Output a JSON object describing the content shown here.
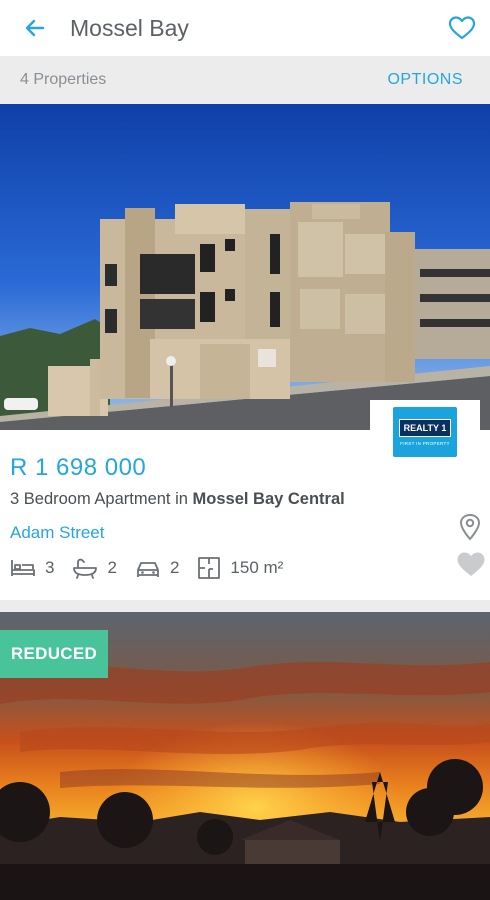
{
  "header": {
    "title": "Mossel Bay"
  },
  "subbar": {
    "count": "4 Properties",
    "options_label": "OPTIONS"
  },
  "listings": [
    {
      "price": "R 1 698 000",
      "description_prefix": "3 Bedroom Apartment in ",
      "description_location": "Mossel Bay Central",
      "street": "Adam Street",
      "bedrooms": "3",
      "bathrooms": "2",
      "garages": "2",
      "floor_size": "150 m²",
      "agency_logo_text": "REALTY 1",
      "agency_logo_subtext": "FIRST IN PROPERTY"
    },
    {
      "badge": "REDUCED"
    }
  ],
  "colors": {
    "accent": "#25a6e0",
    "badge_green": "#49c49a"
  },
  "icons": [
    "back-arrow-icon",
    "heart-outline-icon",
    "map-pin-icon",
    "bed-icon",
    "bath-icon",
    "car-icon",
    "floor-plan-icon"
  ]
}
